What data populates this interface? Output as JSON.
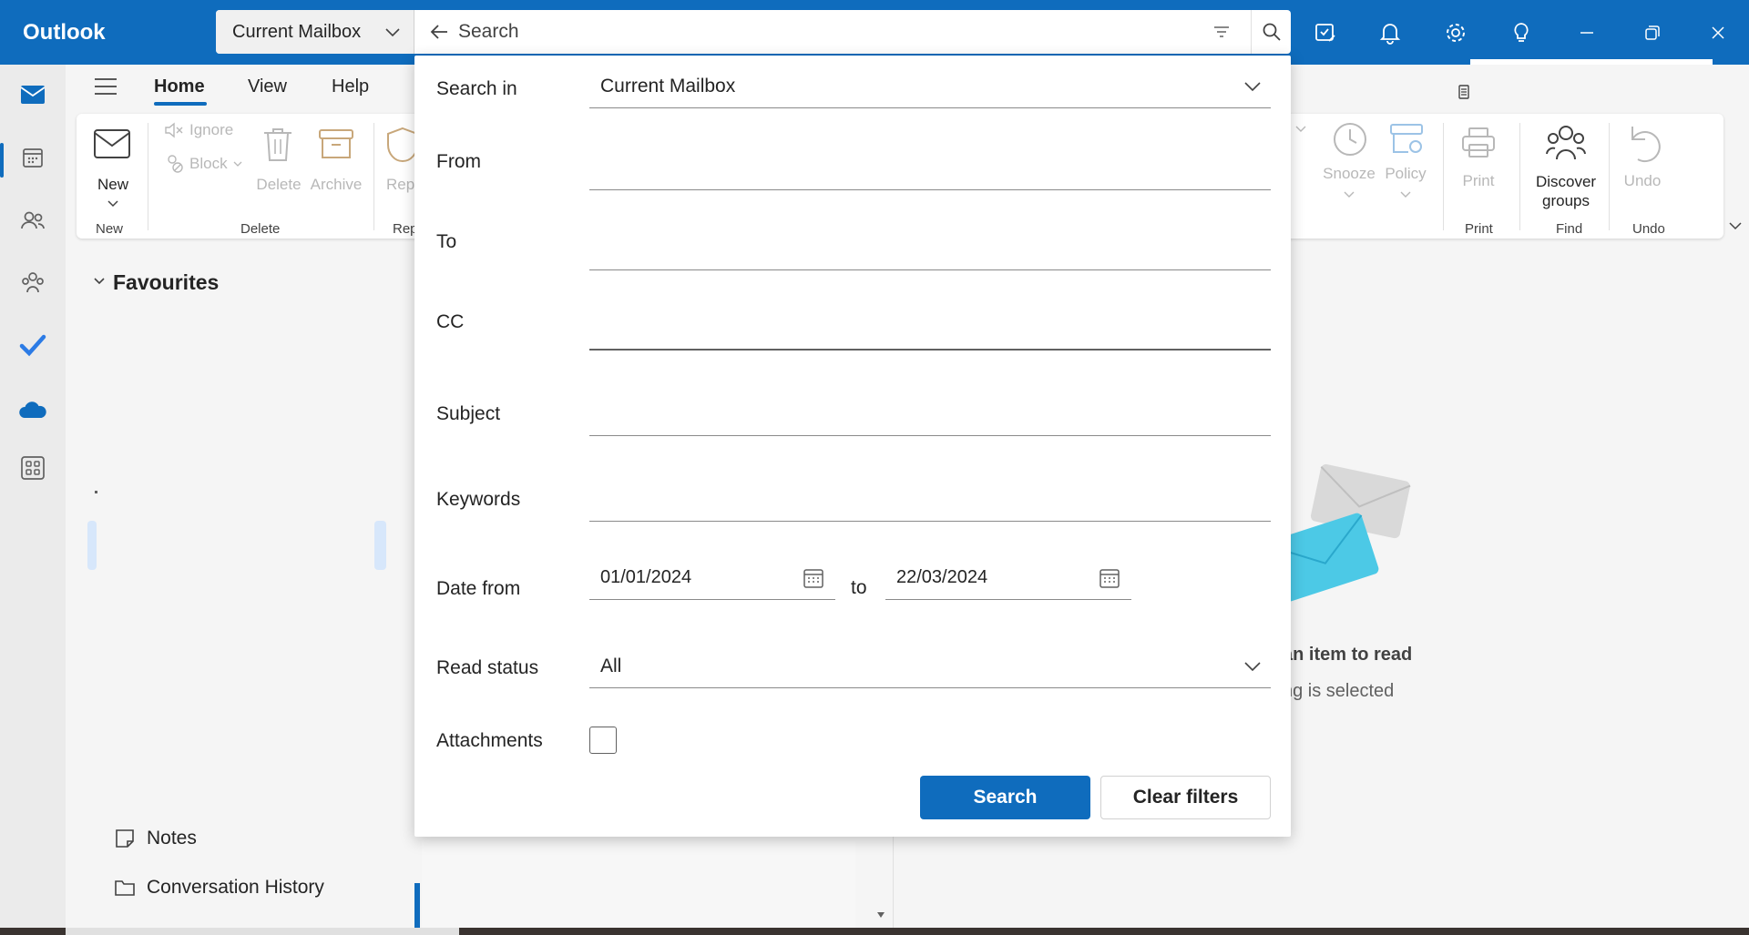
{
  "titlebar": {
    "app_name": "Outlook",
    "search_scope": "Current Mailbox",
    "search_placeholder": "Search",
    "icons": [
      "my-day-icon",
      "bell-icon",
      "gear-icon",
      "lightbulb-icon",
      "minimize-icon",
      "restore-icon",
      "close-icon"
    ]
  },
  "rail": {
    "items": [
      "mail-icon",
      "calendar-icon",
      "people-icon",
      "groups-icon",
      "todo-icon",
      "onedrive-icon",
      "apps-icon"
    ]
  },
  "tabs": {
    "home": "Home",
    "view": "View",
    "help": "Help"
  },
  "ribbon": {
    "new_label": "New",
    "new_group": "New",
    "ignore_label": "Ignore",
    "block_label": "Block",
    "delete_label": "Delete",
    "archive_label": "Archive",
    "delete_group": "Delete",
    "report_label": "Rep",
    "report_group": "Rep",
    "snooze_label": "Snooze",
    "policy_label": "Policy",
    "print_label": "Print",
    "print_group": "Print",
    "discover_label": "Discover groups",
    "find_group": "Find",
    "undo_label": "Undo",
    "undo_group": "Undo"
  },
  "folders": {
    "favourites": "Favourites",
    "notes": "Notes",
    "conversation_history": "Conversation History"
  },
  "reading_pane": {
    "title": "an item to read",
    "subtitle": "ng is selected"
  },
  "search_panel": {
    "search_in_label": "Search in",
    "search_in_value": "Current Mailbox",
    "from_label": "From",
    "to_label": "To",
    "cc_label": "CC",
    "subject_label": "Subject",
    "keywords_label": "Keywords",
    "date_from_label": "Date from",
    "date_from_value": "01/01/2024",
    "date_to_word": "to",
    "date_to_value": "22/03/2024",
    "read_status_label": "Read status",
    "read_status_value": "All",
    "attachments_label": "Attachments",
    "attachments_checked": false,
    "search_button": "Search",
    "clear_button": "Clear filters"
  }
}
